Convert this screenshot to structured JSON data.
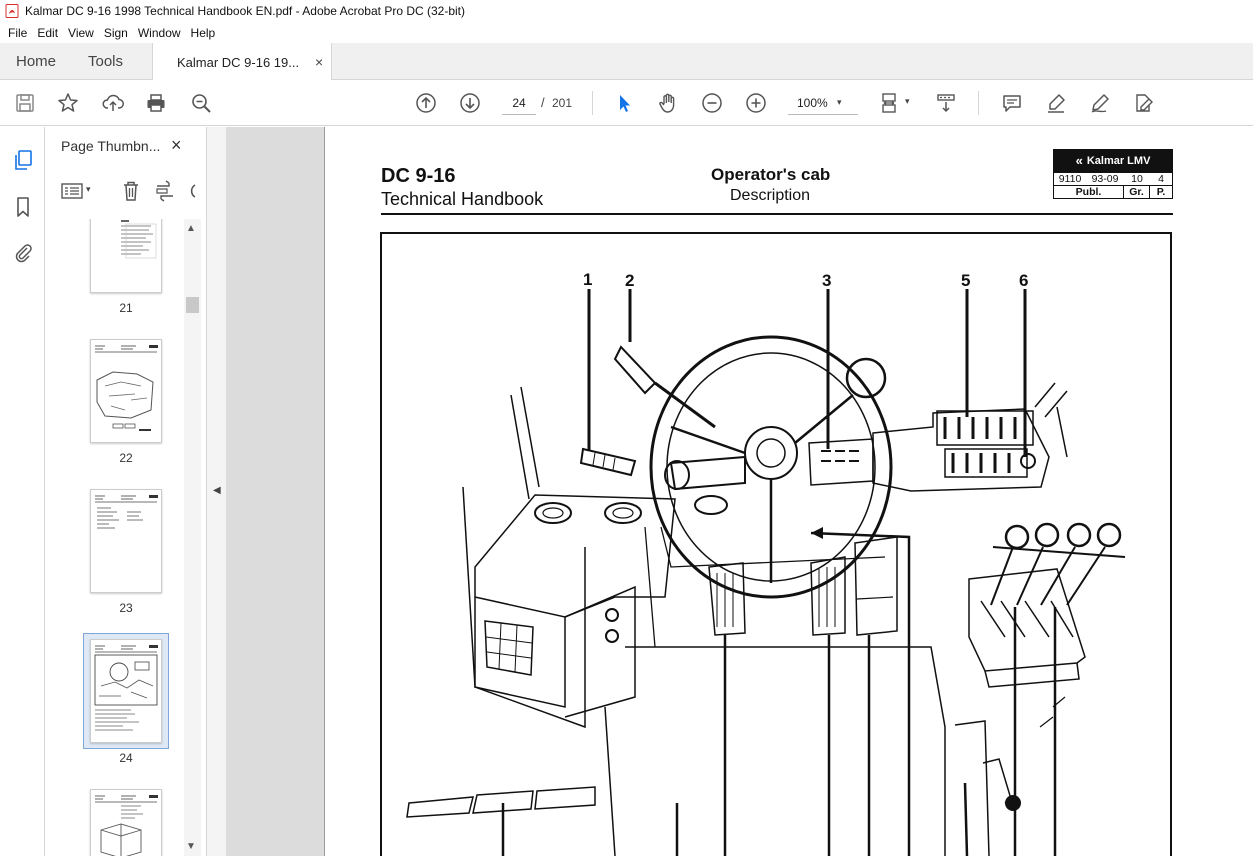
{
  "window": {
    "title": "Kalmar DC 9-16 1998 Technical Handbook EN.pdf - Adobe Acrobat Pro DC (32-bit)"
  },
  "menu": [
    "File",
    "Edit",
    "View",
    "Sign",
    "Window",
    "Help"
  ],
  "tabs": {
    "home": "Home",
    "tools": "Tools",
    "document": "Kalmar DC 9-16 19...",
    "close_glyph": "×"
  },
  "toolbar": {
    "page_current": "24",
    "page_separator": "/",
    "page_total": "201",
    "zoom": "100%",
    "zoom_caret": "▾"
  },
  "icons": {
    "save": "save-icon",
    "bookmark_star": "star-icon",
    "upload": "upload-icon",
    "print": "print-icon",
    "zoom_search": "magnifier-icon",
    "prev_page": "arrow-up-circle-icon",
    "next_page": "arrow-down-circle-icon",
    "select": "cursor-icon",
    "hand": "hand-icon",
    "zoom_out": "minus-circle-icon",
    "zoom_in": "plus-circle-icon",
    "fit": "fit-page-icon",
    "scroll_mode": "scroll-mode-icon",
    "comment": "comment-icon",
    "highlight": "highlight-pen-icon",
    "draw": "draw-icon",
    "fill_sign": "fill-sign-icon"
  },
  "side_panel": {
    "title": "Page Thumbn...",
    "close_glyph": "×",
    "thumbnails": [
      {
        "page": "21"
      },
      {
        "page": "22"
      },
      {
        "page": "23"
      },
      {
        "page": "24",
        "selected": true
      },
      {
        "page": ""
      }
    ]
  },
  "colors": {
    "accent_blue": "#1473e6",
    "icon_gray": "#555555",
    "selected_thumb_bg": "#dfe9f6",
    "pdf_icon_red": "#d8312e"
  },
  "document": {
    "model": "DC 9-16",
    "subtitle": "Technical Handbook",
    "section": "Operator's cab",
    "section_sub": "Description",
    "brand": "Kalmar LMV",
    "ref_values": [
      "9110",
      "93-09",
      "10",
      "4"
    ],
    "ref_headers": [
      "Publ.",
      "Gr.",
      "P."
    ],
    "callouts": [
      "1",
      "2",
      "3",
      "5",
      "6"
    ]
  }
}
